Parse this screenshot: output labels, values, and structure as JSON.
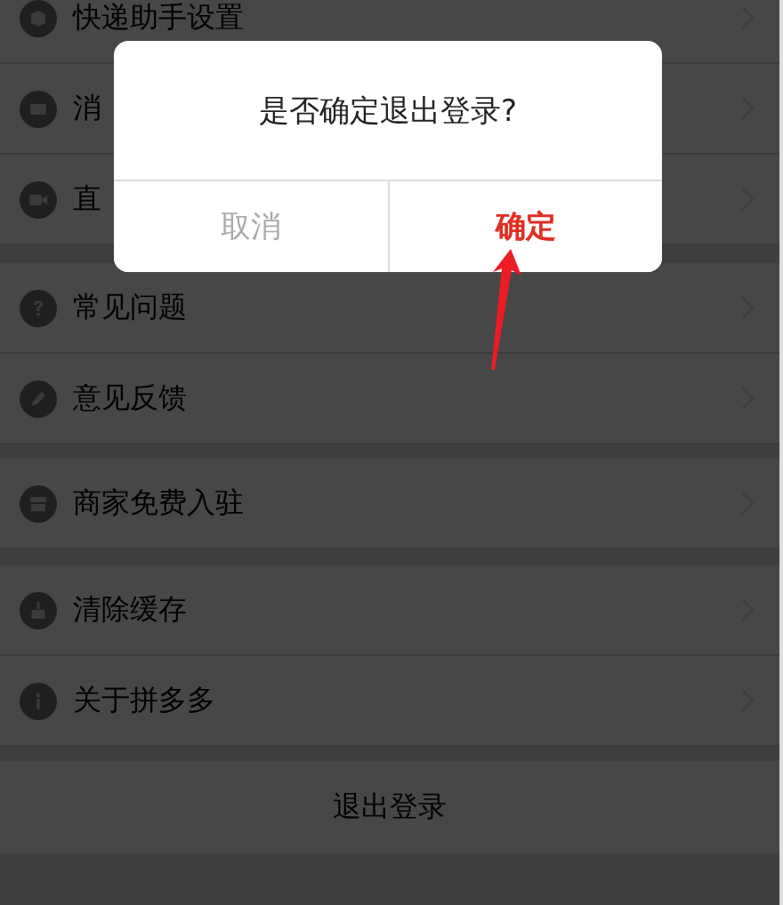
{
  "settings": {
    "sections": [
      {
        "items": [
          {
            "kind": "box",
            "label": "快递助手设置"
          },
          {
            "kind": "mail",
            "label": "消"
          },
          {
            "kind": "video",
            "label": "直"
          }
        ]
      },
      {
        "items": [
          {
            "kind": "help",
            "label": "常见问题"
          },
          {
            "kind": "edit",
            "label": "意见反馈"
          }
        ]
      },
      {
        "items": [
          {
            "kind": "store",
            "label": "商家免费入驻"
          }
        ]
      },
      {
        "items": [
          {
            "kind": "broom",
            "label": "清除缓存"
          },
          {
            "kind": "info",
            "label": "关于拼多多"
          }
        ]
      }
    ],
    "logout": "退出登录"
  },
  "dialog": {
    "message": "是否确定退出登录?",
    "buttons": [
      {
        "kind": "cancel",
        "label": "取消"
      },
      {
        "kind": "confirm",
        "label": "确定"
      }
    ]
  }
}
